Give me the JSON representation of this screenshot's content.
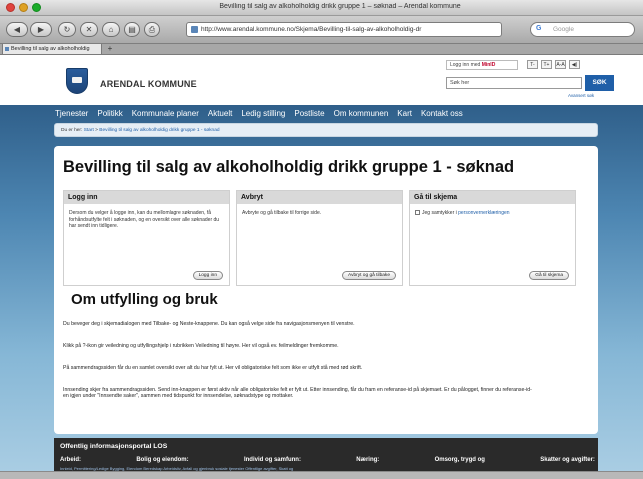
{
  "browser": {
    "window_title": "Bevilling til salg av alkoholholdig drikk gruppe 1 – søknad – Arendal kommune",
    "url": "http://www.arendal.kommune.no/Skjema/Bevilling-til-salg-av-alkoholholdig-dr",
    "search_placeholder": "Google",
    "tab_title": "Bevilling til salg av alkoholholdig",
    "new_tab": "+",
    "buttons": {
      "back": "◀",
      "forward": "▶",
      "reload": "↻",
      "home": "⌂",
      "stop": "✕"
    }
  },
  "header": {
    "logo_text": "ARENDAL KOMMUNE",
    "login_prefix": "Logg inn med ",
    "login_provider": "MinID",
    "font_buttons": [
      "T-",
      "T+",
      "A-A",
      "◀)"
    ],
    "search_value": "Søk her",
    "search_button": "SØK",
    "advanced_search": "Avansert søk"
  },
  "nav": [
    "Tjenester",
    "Politikk",
    "Kommunale planer",
    "Aktuelt",
    "Ledig stilling",
    "Postliste",
    "Om kommunen",
    "Kart",
    "Kontakt oss"
  ],
  "breadcrumb": {
    "prefix": "Du er her:",
    "items": [
      "Start",
      "Bevilling til salg av alkoholholdig drikk gruppe 1 - søknad"
    ],
    "separator": " > "
  },
  "page": {
    "title": "Bevilling til salg av alkoholholdig drikk gruppe 1 - søknad",
    "boxes": {
      "login": {
        "title": "Logg inn",
        "text": "Dersom du velger å logge inn, kan du mellomlagre søknaden, få forhåndsutfylte felt i søknaden, og en oversikt over alle søknader du har sendt inn tidligere.",
        "button": "Logg inn"
      },
      "cancel": {
        "title": "Avbryt",
        "text": "Avbryte og gå tilbake til forrige side.",
        "button": "Avbryt og gå tilbake"
      },
      "goto": {
        "title": "Gå til skjema",
        "checkbox_label": "Jeg samtykker i ",
        "checkbox_link": "personvernerklæringen",
        "button": "Gå til skjema"
      }
    },
    "section_title": "Om utfylling og bruk",
    "paragraphs": [
      "Du beveger deg i skjemadialogen med Tilbake- og Neste-knappene. Du kan også velge side fra navigasjonsmenyen til venstre.",
      "Klikk på ?-ikon gir veiledning og utfyllingshjelp i rubrikken Veiledning til høyre. Her vil også ev. feilmeldinger fremkomme.",
      "På sammendragssiden får du en samlet oversikt over alt du har fylt ut. Her vil obligatoriske felt som ikke er utfylt stå med rød skrift.",
      "Innsending skjer fra sammendragssiden. Send inn-knappen er først aktiv når alle obligatoriske felt er fylt ut. Etter innsending, får du fram en referanse-id på skjemaet. Er du pålogget, finner du referanse-id-en igjen under \"Innsendte saker\", sammen med tidspunkt for innsendelse, søknadstype og mottaker."
    ]
  },
  "footer": {
    "title": "Offentlig informasjonsportal LOS",
    "columns": [
      "Arbeid:",
      "Bolig og eiendom:",
      "Individ og samfunn:",
      "Næring:",
      "Omsorg, trygd og",
      "Skatter og avgifter:"
    ],
    "sub": "Innleid, Permittering/Ledige  Bygging, Eiendom  Beredskap  Arbeidsliv, Avfall og gjenbruk  sosiale tjenester  Offentlige avgifter, Skatt og"
  },
  "colors": {
    "brand_blue": "#1f5fa8",
    "nav_bg": "#2f5f8a",
    "footer_bg": "#2a2a2a",
    "box_head": "#d9d9d9"
  }
}
